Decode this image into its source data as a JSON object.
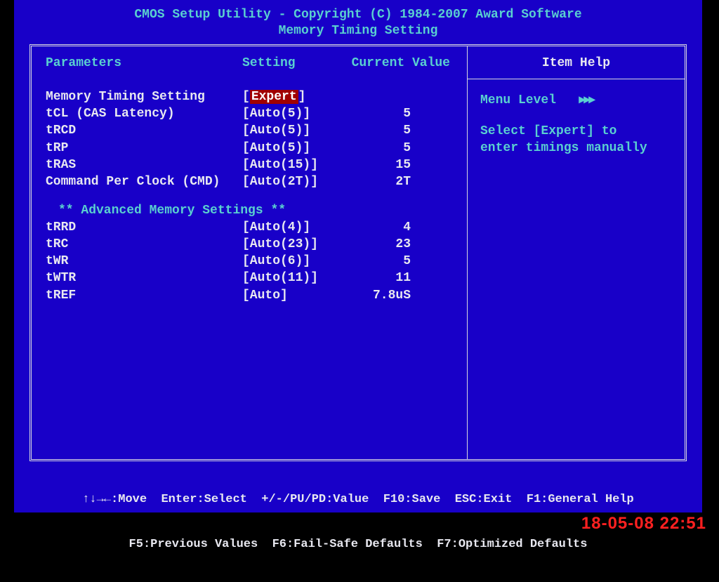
{
  "header": {
    "title": "CMOS Setup Utility - Copyright (C) 1984-2007 Award Software",
    "subtitle": "Memory Timing Setting"
  },
  "columns": {
    "parameters": "Parameters",
    "setting": "Setting",
    "current": "Current Value"
  },
  "rows_main": [
    {
      "param": "Memory Timing Setting",
      "setting_pre": "[",
      "setting_sel": "Expert",
      "setting_post": "]",
      "value": ""
    },
    {
      "param": "tCL (CAS Latency)",
      "setting": "[Auto(5)]",
      "value": "5"
    },
    {
      "param": "tRCD",
      "setting": "[Auto(5)]",
      "value": "5"
    },
    {
      "param": "tRP",
      "setting": "[Auto(5)]",
      "value": "5"
    },
    {
      "param": "tRAS",
      "setting": "[Auto(15)]",
      "value": "15"
    },
    {
      "param": "Command Per Clock (CMD)",
      "setting": "[Auto(2T)]",
      "value": "2T"
    }
  ],
  "section": "** Advanced Memory Settings **",
  "rows_adv": [
    {
      "param": "tRRD",
      "setting": "[Auto(4)]",
      "value": "4"
    },
    {
      "param": "tRC",
      "setting": "[Auto(23)]",
      "value": "23"
    },
    {
      "param": "tWR",
      "setting": "[Auto(6)]",
      "value": "5"
    },
    {
      "param": "tWTR",
      "setting": "[Auto(11)]",
      "value": "11"
    },
    {
      "param": "tREF",
      "setting": "[Auto]",
      "value": "7.8uS"
    }
  ],
  "help": {
    "title": "Item Help",
    "menu_level_label": "Menu Level",
    "menu_level_arrows": "▸▸▸",
    "text_line1": "Select [Expert] to",
    "text_line2": "enter timings manually"
  },
  "footer": {
    "line1": "↑↓→←:Move  Enter:Select  +/-/PU/PD:Value  F10:Save  ESC:Exit  F1:General Help",
    "line2": "F5:Previous Values  F6:Fail-Safe Defaults  F7:Optimized Defaults"
  },
  "camera_timestamp": "18-05-08 22:51"
}
